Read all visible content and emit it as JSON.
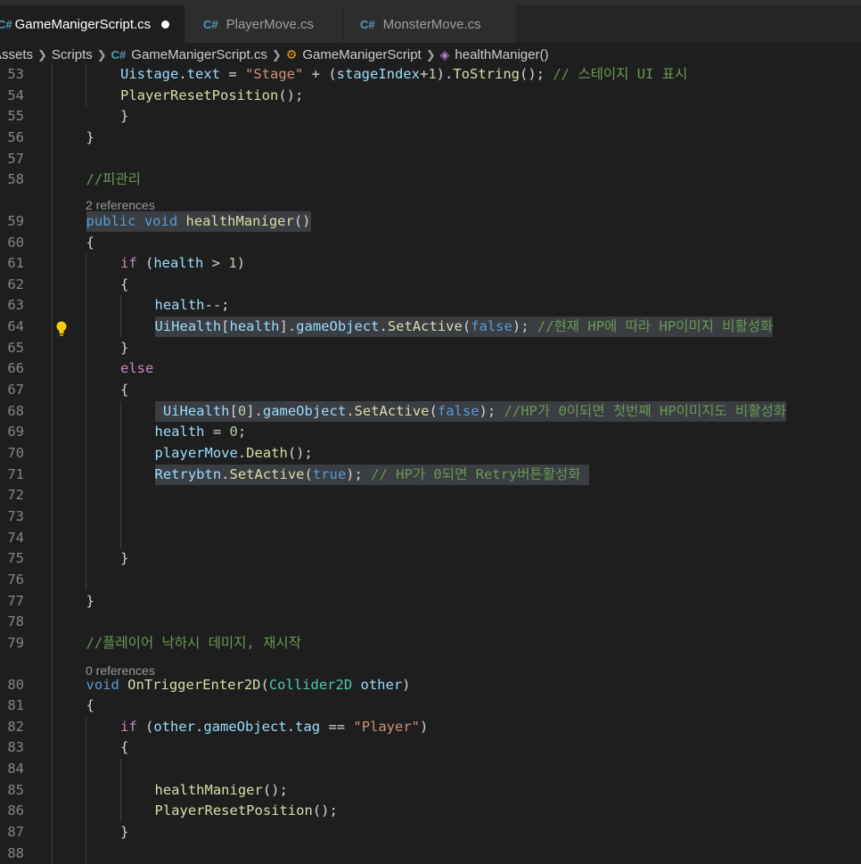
{
  "tabs": [
    {
      "icon": "csharp-file-icon",
      "label": "GameManigerScript.cs",
      "active": true,
      "modified": true
    },
    {
      "icon": "csharp-file-icon",
      "label": "PlayerMove.cs",
      "active": false
    },
    {
      "icon": "csharp-file-icon",
      "label": "MonsterMove.cs",
      "active": false
    }
  ],
  "breadcrumb": {
    "items": [
      "Assets",
      "Scripts",
      "GameManigerScript.cs",
      "GameManigerScript",
      "healthManiger()"
    ],
    "icons": [
      "",
      "",
      "csharp-file-icon",
      "class-icon",
      "method-icon"
    ]
  },
  "codelens": {
    "refs_59": "2 references",
    "refs_80": "0 references"
  },
  "colors": {
    "background": "#1e1e1e",
    "keyword": "#569cd6",
    "function": "#dcdcaa",
    "string": "#ce9178",
    "number": "#b5cea8",
    "comment": "#6a9955",
    "variable": "#9cdcfe",
    "control": "#c586c0",
    "type": "#4ec9b0"
  },
  "lines": [
    {
      "n": "53",
      "indent": 2,
      "tokens": [
        [
          "vr",
          "Uistage"
        ],
        [
          "",
          "."
        ],
        [
          "vr",
          "text"
        ],
        [
          "",
          " = "
        ],
        [
          "str",
          "\"Stage\""
        ],
        [
          "",
          " + ("
        ],
        [
          "vr",
          "stageIndex"
        ],
        [
          "",
          "+"
        ],
        [
          "num",
          "1"
        ],
        [
          "",
          ")."
        ],
        [
          "fn",
          "ToString"
        ],
        [
          "",
          "(); "
        ],
        [
          "cm",
          "// 스테이지 UI 표시"
        ]
      ]
    },
    {
      "n": "54",
      "indent": 2,
      "tokens": [
        [
          "fn",
          "PlayerResetPosition"
        ],
        [
          "",
          "();"
        ]
      ]
    },
    {
      "n": "55",
      "indent": 2,
      "tokens": [
        [
          "",
          "}"
        ]
      ]
    },
    {
      "n": "56",
      "indent": 1,
      "tokens": [
        [
          "",
          "}"
        ]
      ]
    },
    {
      "n": "57",
      "indent": 0,
      "tokens": []
    },
    {
      "n": "58",
      "indent": 1,
      "tokens": [
        [
          "cm",
          "//피관리"
        ]
      ]
    },
    {
      "n": "59",
      "indent": 1,
      "tokens": [
        [
          "kw",
          "public"
        ],
        [
          "",
          " "
        ],
        [
          "kw",
          "void"
        ],
        [
          "",
          " "
        ],
        [
          "fn",
          "healthManiger"
        ],
        [
          "",
          "()"
        ]
      ],
      "highlight": true
    },
    {
      "n": "60",
      "indent": 1,
      "tokens": [
        [
          "",
          "{"
        ]
      ]
    },
    {
      "n": "61",
      "indent": 2,
      "tokens": [
        [
          "ctl",
          "if"
        ],
        [
          "",
          " ("
        ],
        [
          "vr",
          "health"
        ],
        [
          "",
          " > "
        ],
        [
          "num",
          "1"
        ],
        [
          "",
          ")"
        ]
      ]
    },
    {
      "n": "62",
      "indent": 2,
      "tokens": [
        [
          "",
          "{"
        ]
      ]
    },
    {
      "n": "63",
      "indent": 3,
      "tokens": [
        [
          "vr",
          "health"
        ],
        [
          "",
          "--;"
        ]
      ]
    },
    {
      "n": "64",
      "indent": 3,
      "tokens": [
        [
          "vr",
          "UiHealth"
        ],
        [
          "",
          "["
        ],
        [
          "vr",
          "health"
        ],
        [
          "",
          "]."
        ],
        [
          "vr",
          "gameObject"
        ],
        [
          "",
          "."
        ],
        [
          "fn",
          "SetActive"
        ],
        [
          "",
          "("
        ],
        [
          "kw",
          "false"
        ],
        [
          "",
          "); "
        ],
        [
          "cm",
          "//현재 HP에 따라 HP이미지 비활성화"
        ]
      ],
      "highlight": true
    },
    {
      "n": "65",
      "indent": 2,
      "tokens": [
        [
          "",
          "}"
        ]
      ]
    },
    {
      "n": "66",
      "indent": 2,
      "tokens": [
        [
          "ctl",
          "else"
        ]
      ]
    },
    {
      "n": "67",
      "indent": 2,
      "tokens": [
        [
          "",
          "{"
        ]
      ]
    },
    {
      "n": "68",
      "indent": 3,
      "tokens": [
        [
          "",
          " "
        ],
        [
          "vr",
          "UiHealth"
        ],
        [
          "",
          "["
        ],
        [
          "num",
          "0"
        ],
        [
          "",
          "]."
        ],
        [
          "vr",
          "gameObject"
        ],
        [
          "",
          "."
        ],
        [
          "fn",
          "SetActive"
        ],
        [
          "",
          "("
        ],
        [
          "kw",
          "false"
        ],
        [
          "",
          "); "
        ],
        [
          "cm",
          "//HP가 0이되면 첫번째 HP이미지도 비활성화"
        ]
      ],
      "highlight": true
    },
    {
      "n": "69",
      "indent": 3,
      "tokens": [
        [
          "vr",
          "health"
        ],
        [
          "",
          " = "
        ],
        [
          "num",
          "0"
        ],
        [
          "",
          ";"
        ]
      ]
    },
    {
      "n": "70",
      "indent": 3,
      "tokens": [
        [
          "vr",
          "playerMove"
        ],
        [
          "",
          "."
        ],
        [
          "fn",
          "Death"
        ],
        [
          "",
          "();"
        ]
      ]
    },
    {
      "n": "71",
      "indent": 3,
      "tokens": [
        [
          "vr",
          "Retrybtn"
        ],
        [
          "",
          "."
        ],
        [
          "fn",
          "SetActive"
        ],
        [
          "",
          "("
        ],
        [
          "kw",
          "true"
        ],
        [
          "",
          "); "
        ],
        [
          "cm",
          "// HP가 0되면 Retry버튼활성화 "
        ]
      ],
      "highlight": true
    },
    {
      "n": "72",
      "indent": 0,
      "tokens": []
    },
    {
      "n": "73",
      "indent": 0,
      "tokens": []
    },
    {
      "n": "74",
      "indent": 0,
      "tokens": []
    },
    {
      "n": "75",
      "indent": 2,
      "tokens": [
        [
          "",
          "}"
        ]
      ]
    },
    {
      "n": "76",
      "indent": 0,
      "tokens": []
    },
    {
      "n": "77",
      "indent": 1,
      "tokens": [
        [
          "",
          "}"
        ]
      ]
    },
    {
      "n": "78",
      "indent": 0,
      "tokens": []
    },
    {
      "n": "79",
      "indent": 1,
      "tokens": [
        [
          "cm",
          "//플레이어 낙하시 데미지, 재시작"
        ]
      ]
    },
    {
      "n": "80",
      "indent": 1,
      "tokens": [
        [
          "kw",
          "void"
        ],
        [
          "",
          " "
        ],
        [
          "fn",
          "OnTriggerEnter2D"
        ],
        [
          "",
          "("
        ],
        [
          "ty",
          "Collider2D"
        ],
        [
          "",
          " "
        ],
        [
          "vr",
          "other"
        ],
        [
          "",
          ")"
        ]
      ]
    },
    {
      "n": "81",
      "indent": 1,
      "tokens": [
        [
          "",
          "{"
        ]
      ]
    },
    {
      "n": "82",
      "indent": 2,
      "tokens": [
        [
          "ctl",
          "if"
        ],
        [
          "",
          " ("
        ],
        [
          "vr",
          "other"
        ],
        [
          "",
          "."
        ],
        [
          "vr",
          "gameObject"
        ],
        [
          "",
          "."
        ],
        [
          "vr",
          "tag"
        ],
        [
          "",
          " == "
        ],
        [
          "str",
          "\"Player\""
        ],
        [
          "",
          ")"
        ]
      ]
    },
    {
      "n": "83",
      "indent": 2,
      "tokens": [
        [
          "",
          "{"
        ]
      ]
    },
    {
      "n": "84",
      "indent": 0,
      "tokens": []
    },
    {
      "n": "85",
      "indent": 3,
      "tokens": [
        [
          "fn",
          "healthManiger"
        ],
        [
          "",
          "();"
        ]
      ]
    },
    {
      "n": "86",
      "indent": 3,
      "tokens": [
        [
          "fn",
          "PlayerResetPosition"
        ],
        [
          "",
          "();"
        ]
      ]
    },
    {
      "n": "87",
      "indent": 2,
      "tokens": [
        [
          "",
          "}"
        ]
      ]
    },
    {
      "n": "88",
      "indent": 0,
      "tokens": []
    }
  ]
}
